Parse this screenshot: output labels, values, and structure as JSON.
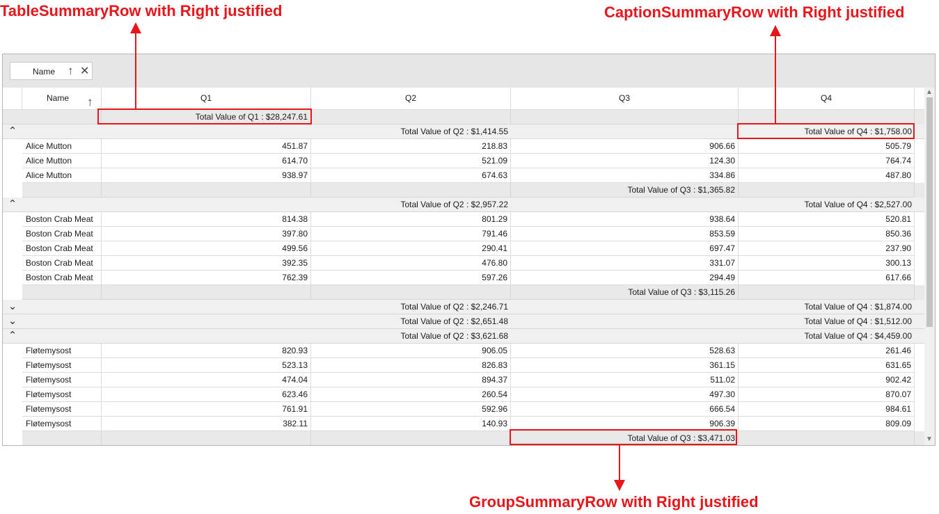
{
  "annotations": {
    "table": "TableSummaryRow with Right justified",
    "caption": "CaptionSummaryRow with Right justified",
    "group": "GroupSummaryRow with Right justified"
  },
  "group_chip": {
    "label": "Name"
  },
  "columns": [
    "Name",
    "Q1",
    "Q2",
    "Q3",
    "Q4"
  ],
  "table_summary": "Total Value of Q1 : $28,247.61",
  "groups": [
    {
      "expanded": true,
      "caption_q2": "Total Value of Q2 : $1,414.55",
      "caption_q4": "Total Value of Q4 : $1,758.00",
      "rows": [
        [
          "Alice Mutton",
          "451.87",
          "218.83",
          "906.66",
          "505.79"
        ],
        [
          "Alice Mutton",
          "614.70",
          "521.09",
          "124.30",
          "764.74"
        ],
        [
          "Alice Mutton",
          "938.97",
          "674.63",
          "334.86",
          "487.80"
        ]
      ],
      "group_summary": "Total Value of Q3 : $1,365.82"
    },
    {
      "expanded": true,
      "caption_q2": "Total Value of Q2 : $2,957.22",
      "caption_q4": "Total Value of Q4 : $2,527.00",
      "rows": [
        [
          "Boston Crab Meat",
          "814.38",
          "801.29",
          "938.64",
          "520.81"
        ],
        [
          "Boston Crab Meat",
          "397.80",
          "791.46",
          "853.59",
          "850.36"
        ],
        [
          "Boston Crab Meat",
          "499.56",
          "290.41",
          "697.47",
          "237.90"
        ],
        [
          "Boston Crab Meat",
          "392.35",
          "476.80",
          "331.07",
          "300.13"
        ],
        [
          "Boston Crab Meat",
          "762.39",
          "597.26",
          "294.49",
          "617.66"
        ]
      ],
      "group_summary": "Total Value of Q3 : $3,115.26"
    },
    {
      "expanded": false,
      "caption_q2": "Total Value of Q2 : $2,246.71",
      "caption_q4": "Total Value of Q4 : $1,874.00",
      "rows": []
    },
    {
      "expanded": false,
      "caption_q2": "Total Value of Q2 : $2,651.48",
      "caption_q4": "Total Value of Q4 : $1,512.00",
      "rows": []
    },
    {
      "expanded": true,
      "caption_q2": "Total Value of Q2 : $3,621.68",
      "caption_q4": "Total Value of Q4 : $4,459.00",
      "rows": [
        [
          "Fløtemysost",
          "820.93",
          "906.05",
          "528.63",
          "261.46"
        ],
        [
          "Fløtemysost",
          "523.13",
          "826.83",
          "361.15",
          "631.65"
        ],
        [
          "Fløtemysost",
          "474.04",
          "894.37",
          "511.02",
          "902.42"
        ],
        [
          "Fløtemysost",
          "623.46",
          "260.54",
          "497.30",
          "870.07"
        ],
        [
          "Fløtemysost",
          "761.91",
          "592.96",
          "666.54",
          "984.61"
        ],
        [
          "Fløtemysost",
          "382.11",
          "140.93",
          "906.39",
          "809.09"
        ]
      ],
      "group_summary": "Total Value of Q3 : $3,471.03"
    }
  ],
  "icons": {
    "sort_ascending": "arrow-up-icon",
    "remove": "close-icon",
    "collapse": "chevron-up-icon",
    "expand": "chevron-down-icon"
  }
}
